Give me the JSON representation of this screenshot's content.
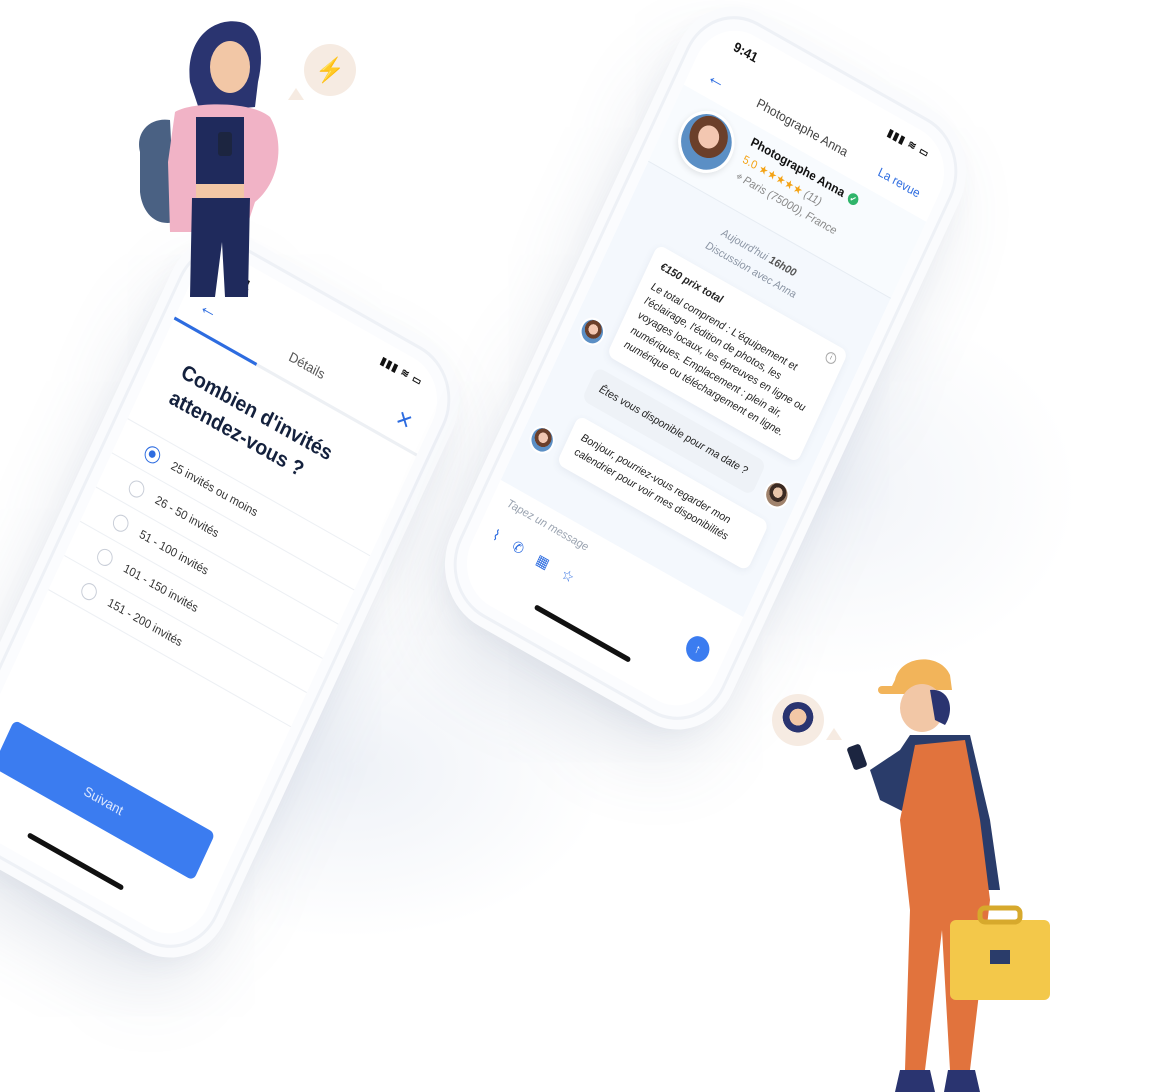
{
  "status_time": "9:41",
  "phone_form": {
    "header": {
      "title": "Détails",
      "back_icon": "arrow-left-icon",
      "close_icon": "close-icon"
    },
    "progress": 0.34,
    "question": "Combien d'invités attendez-vous ?",
    "options": [
      {
        "label": "25 invités ou moins",
        "selected": true
      },
      {
        "label": "26 - 50 invités",
        "selected": false
      },
      {
        "label": "51 - 100 invités",
        "selected": false
      },
      {
        "label": "101 - 150 invités",
        "selected": false
      },
      {
        "label": "151 - 200 invités",
        "selected": false
      }
    ],
    "next_label": "Suivant"
  },
  "phone_chat": {
    "header": {
      "title": "Photographe Anna",
      "review_link": "La revue"
    },
    "profile": {
      "name": "Photographe Anna",
      "rating": "5.0",
      "stars": "★★★★★",
      "review_count": "(11)",
      "location": "Paris (75000), France"
    },
    "day": {
      "label": "Aujourd'hui",
      "time": "16h00",
      "subtitle": "Discussion avec Anna"
    },
    "messages": {
      "quote_price": "€150 prix total",
      "quote_body": "Le total comprend : L'équipement et l'éclairage, l'édition de photos, les voyages locaux, les épreuves en ligne ou numériques. Emplacement : plein air, numérique ou téléchargement en ligne.",
      "user_question": "Êtes vous disponible pour ma date ?",
      "pro_reply": "Bonjour, pourriez-vous regarder mon calendrier pour voir mes disponibilités"
    },
    "composer_placeholder": "Tapez un message"
  },
  "colors": {
    "accent": "#3b7cf0",
    "star": "#f4a315",
    "verified": "#2fb46a"
  }
}
